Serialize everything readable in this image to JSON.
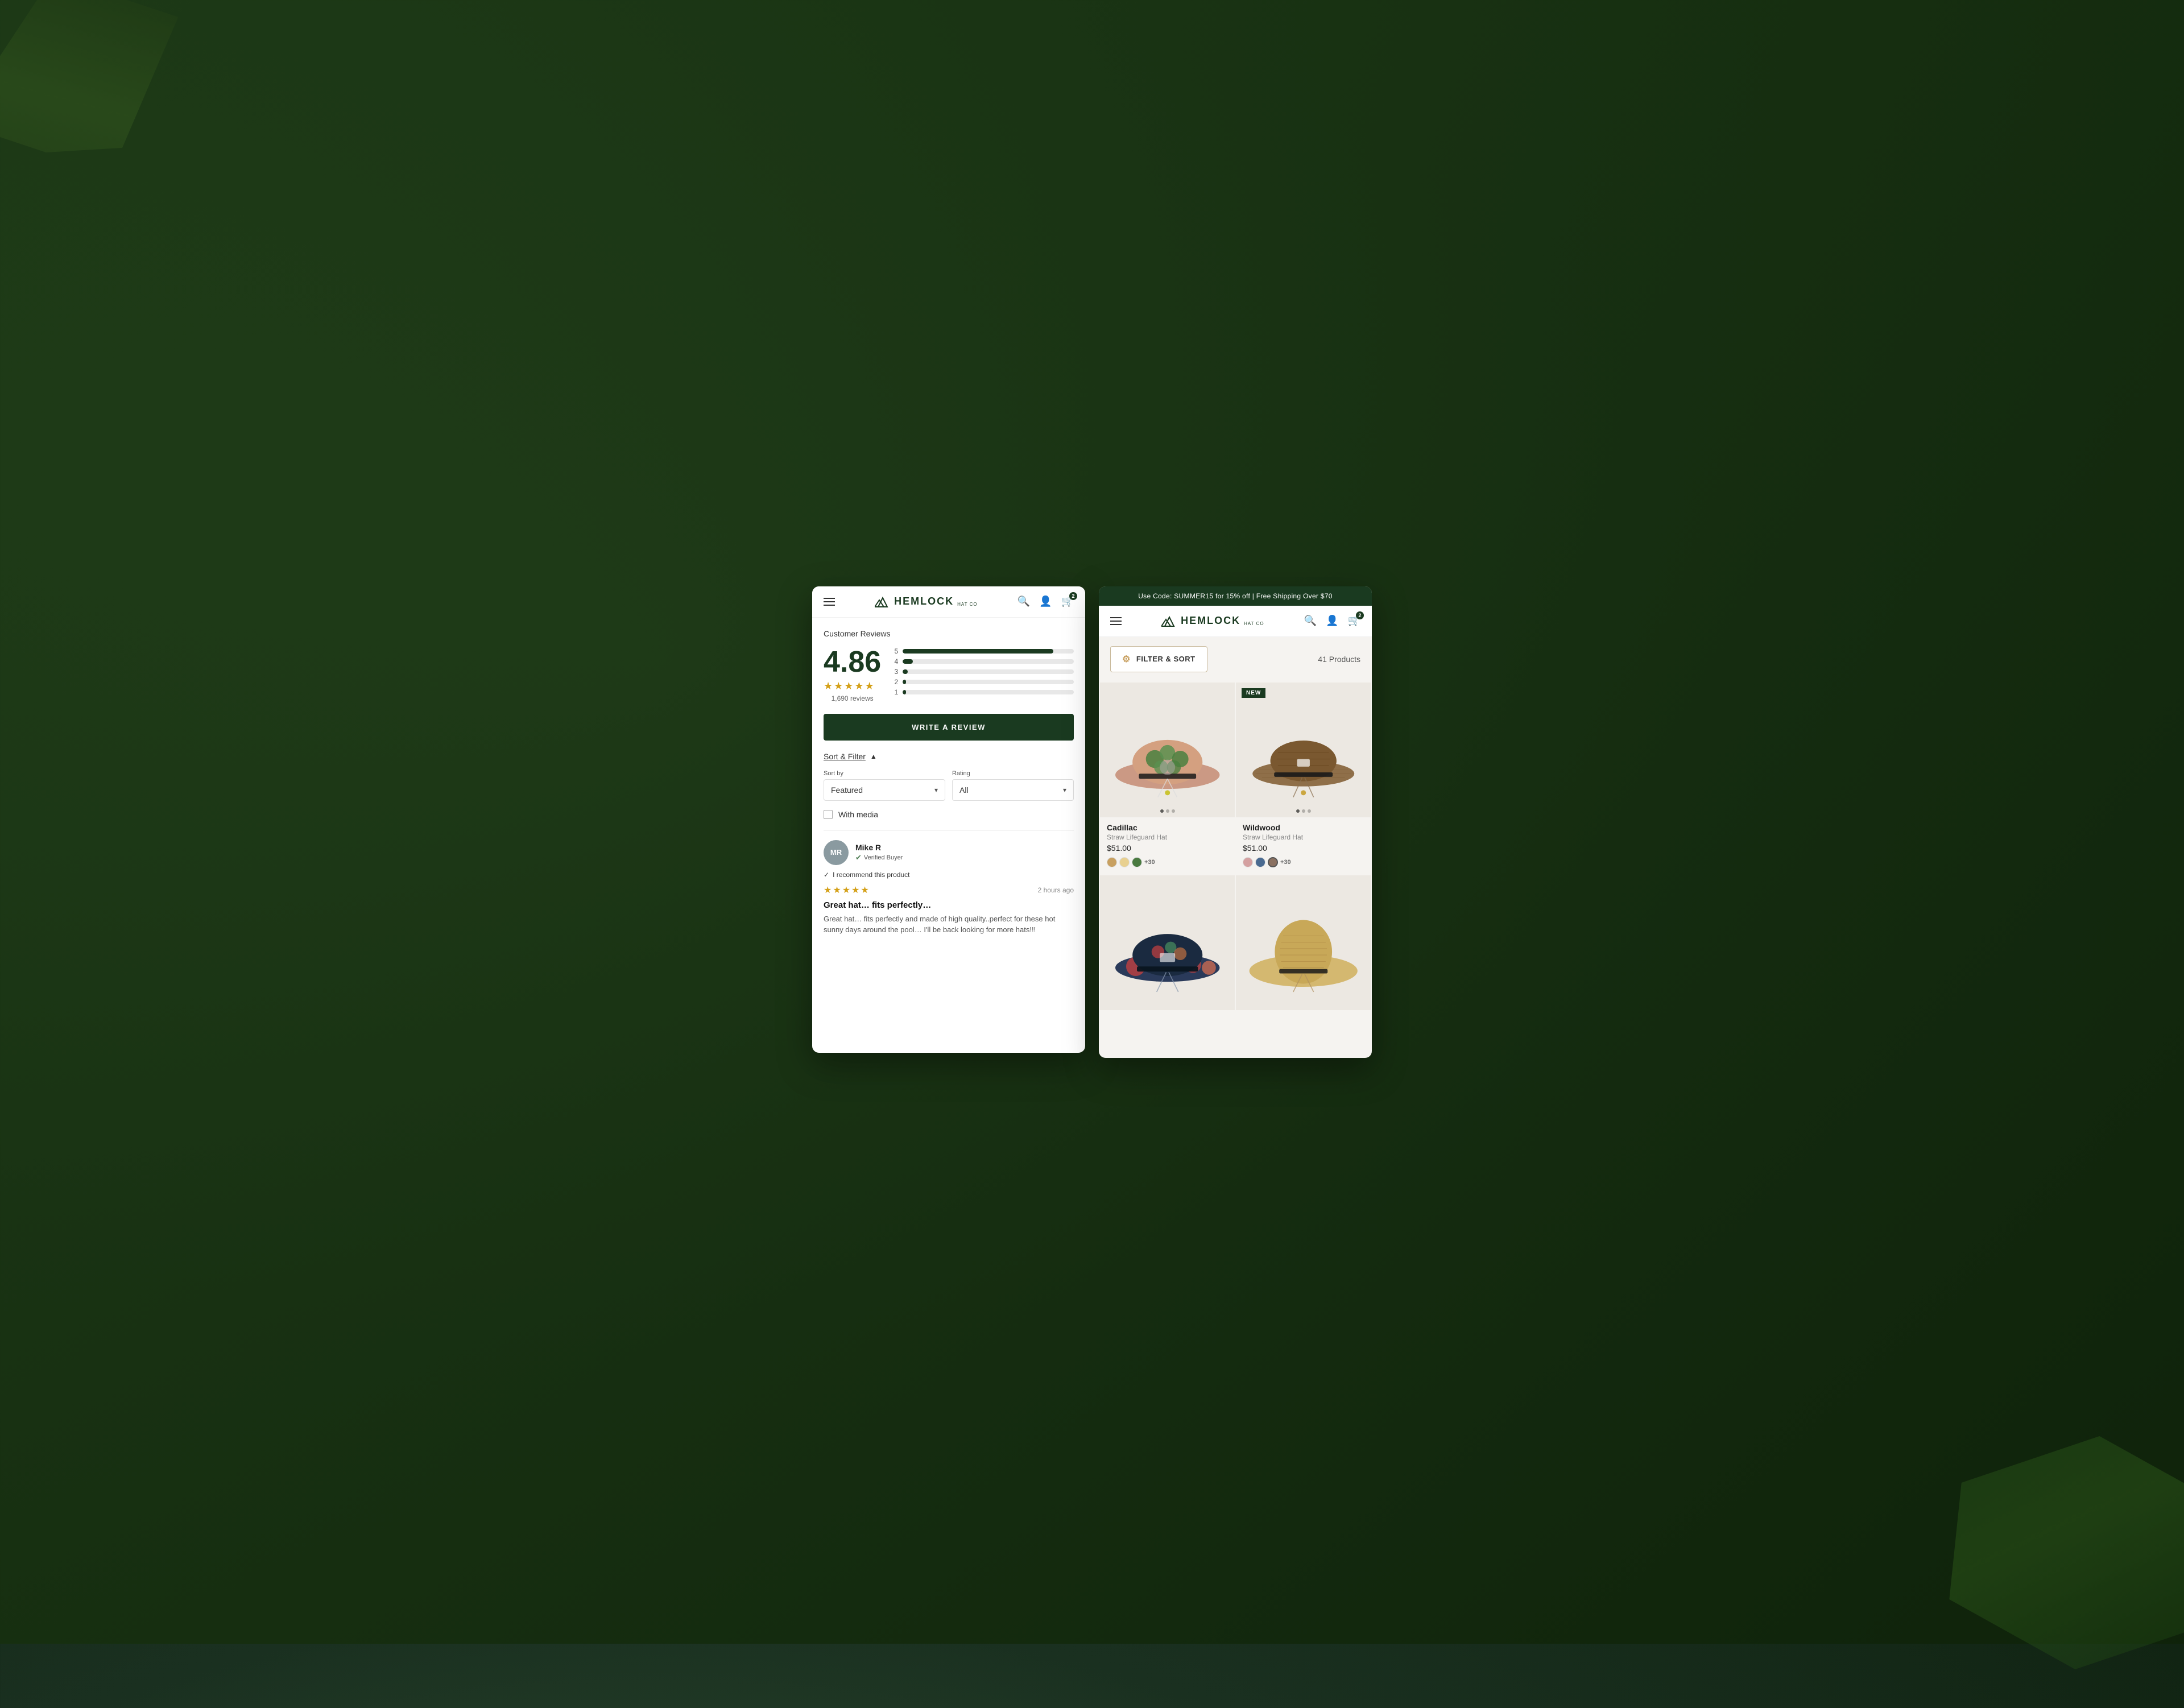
{
  "background": {
    "color": "#2d4a2d"
  },
  "screen_left": {
    "header": {
      "menu_icon": "hamburger",
      "logo_text": "HEMLOCK",
      "logo_subtitle": "HAT CO",
      "search_icon": "search",
      "account_icon": "user",
      "cart_icon": "cart",
      "cart_count": "2"
    },
    "reviews": {
      "title": "Customer Reviews",
      "rating_number": "4.86",
      "reviews_count": "1,690 reviews",
      "stars": 5,
      "bars": [
        {
          "label": "5",
          "fill_percent": 88
        },
        {
          "label": "4",
          "fill_percent": 6
        },
        {
          "label": "3",
          "fill_percent": 3
        },
        {
          "label": "2",
          "fill_percent": 1.5
        },
        {
          "label": "1",
          "fill_percent": 1.5
        }
      ],
      "write_review_btn": "WRITE A REVIEW",
      "sort_filter_label": "Sort & Filter",
      "sort_by_label": "Sort by",
      "sort_by_value": "Featured",
      "rating_label": "Rating",
      "rating_value": "All",
      "with_media_label": "With media",
      "reviewer": {
        "initials": "MR",
        "name": "Mike R",
        "verified": "Verified Buyer",
        "recommend": "I recommend this product",
        "time": "2 hours ago",
        "stars": 5,
        "title": "Great hat… fits perfectly…",
        "body": "Great hat… fits perfectly and made of high quality..perfect for these hot sunny days around the pool… I'll be back looking for more hats!!!"
      }
    }
  },
  "screen_right": {
    "promo_banner": "Use Code: SUMMER15 for 15% off | Free Shipping Over $70",
    "header": {
      "menu_icon": "hamburger",
      "logo_text": "HEMLOCK",
      "logo_subtitle": "HAT CO",
      "search_icon": "search",
      "account_icon": "user",
      "cart_icon": "cart",
      "cart_count": "2"
    },
    "filter_sort_btn": "FILTER & SORT",
    "products_count": "41 Products",
    "products": [
      {
        "name": "Cadillac",
        "type": "Straw Lifeguard Hat",
        "price": "$51.00",
        "badge": null,
        "colors": [
          "#c8a060",
          "#e8c080",
          "#4a7a40"
        ],
        "more_colors": "+30",
        "hat_style": "floral_green"
      },
      {
        "name": "Wildwood",
        "type": "Straw Lifeguard Hat",
        "price": "$51.00",
        "badge": "NEW",
        "colors": [
          "#d4a0a0",
          "#4a6a90",
          "#8a7060"
        ],
        "more_colors": "+30",
        "hat_style": "brown_straw"
      },
      {
        "name": "",
        "type": "",
        "price": "",
        "badge": null,
        "hat_style": "tropical_floral"
      },
      {
        "name": "",
        "type": "",
        "price": "",
        "badge": null,
        "hat_style": "plain_straw"
      }
    ]
  }
}
